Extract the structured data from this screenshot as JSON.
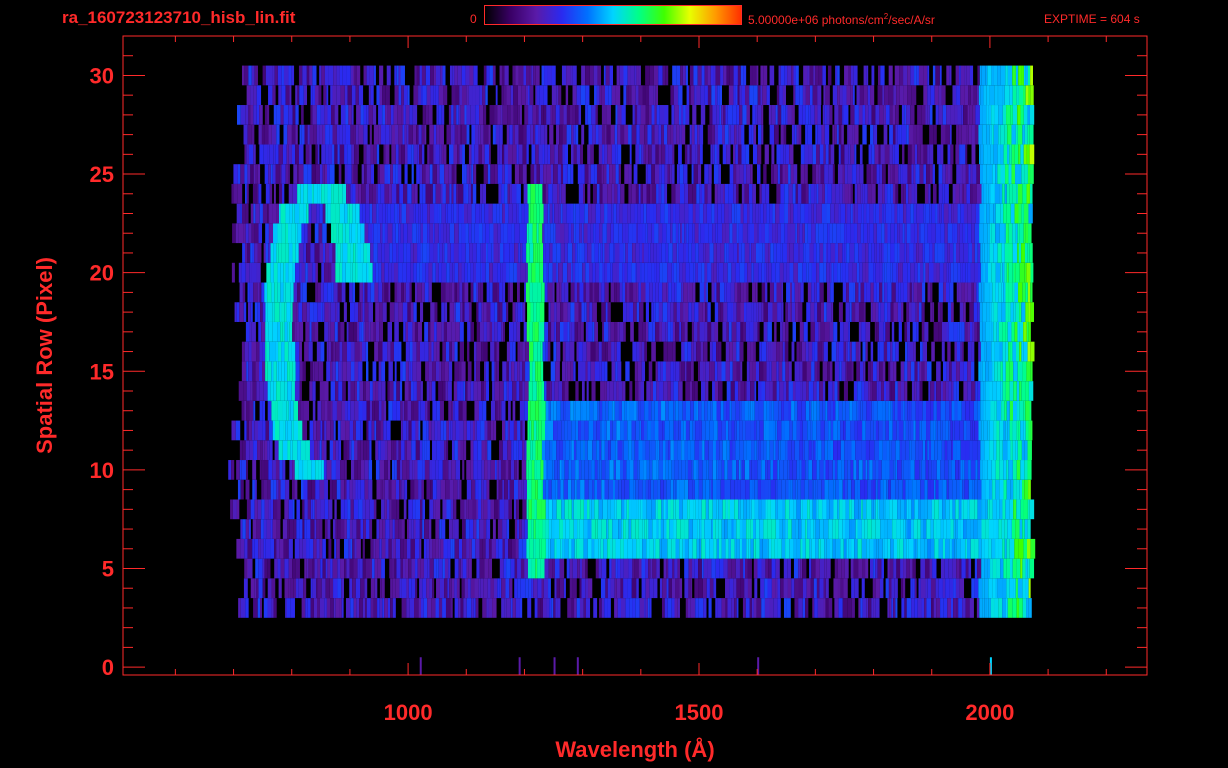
{
  "header": {
    "file_name": "ra_160723123710_hisb_lin.fit",
    "colorbar_min": "0",
    "colorbar_max_value": "5.00000e+06 photons/cm",
    "colorbar_max_exponent": "2",
    "colorbar_max_suffix": "/sec/A/sr",
    "exptime": "EXPTIME = 604 s"
  },
  "colors": {
    "axis": "#ff2a2a",
    "background": "#000000",
    "colormap": [
      "#000000",
      "#3a0066",
      "#5a1aa8",
      "#2a2af0",
      "#0070ff",
      "#00d4ff",
      "#00ff88",
      "#40ff00",
      "#e8ff00",
      "#ff9a00",
      "#ff3000"
    ]
  },
  "chart_data": {
    "type": "heatmap",
    "xlabel": "Wavelength (Å)",
    "ylabel": "Spatial Row (Pixel)",
    "xlim": [
      510,
      2270
    ],
    "ylim": [
      -0.4,
      32
    ],
    "x_ticks": [
      1000,
      1500,
      2000
    ],
    "y_ticks": [
      0,
      5,
      10,
      15,
      20,
      25,
      30
    ],
    "colorbar_range": [
      0,
      5000000
    ],
    "colorbar_units": "photons/cm^2/sec/A/sr",
    "grid": false,
    "signal_x_range": [
      690,
      2070
    ],
    "signal_rows": [
      3,
      30
    ],
    "features": [
      {
        "kind": "emission_line",
        "x": 1216,
        "rows": [
          5,
          24
        ]
      },
      {
        "kind": "continuum_band",
        "x": [
          1216,
          2060
        ],
        "rows": [
          6,
          13
        ]
      },
      {
        "kind": "red_edge",
        "x": [
          1980,
          2070
        ],
        "rows": [
          1,
          30
        ]
      },
      {
        "kind": "curved_arc",
        "x": [
          770,
          980
        ],
        "rows": [
          10,
          24
        ]
      }
    ]
  }
}
